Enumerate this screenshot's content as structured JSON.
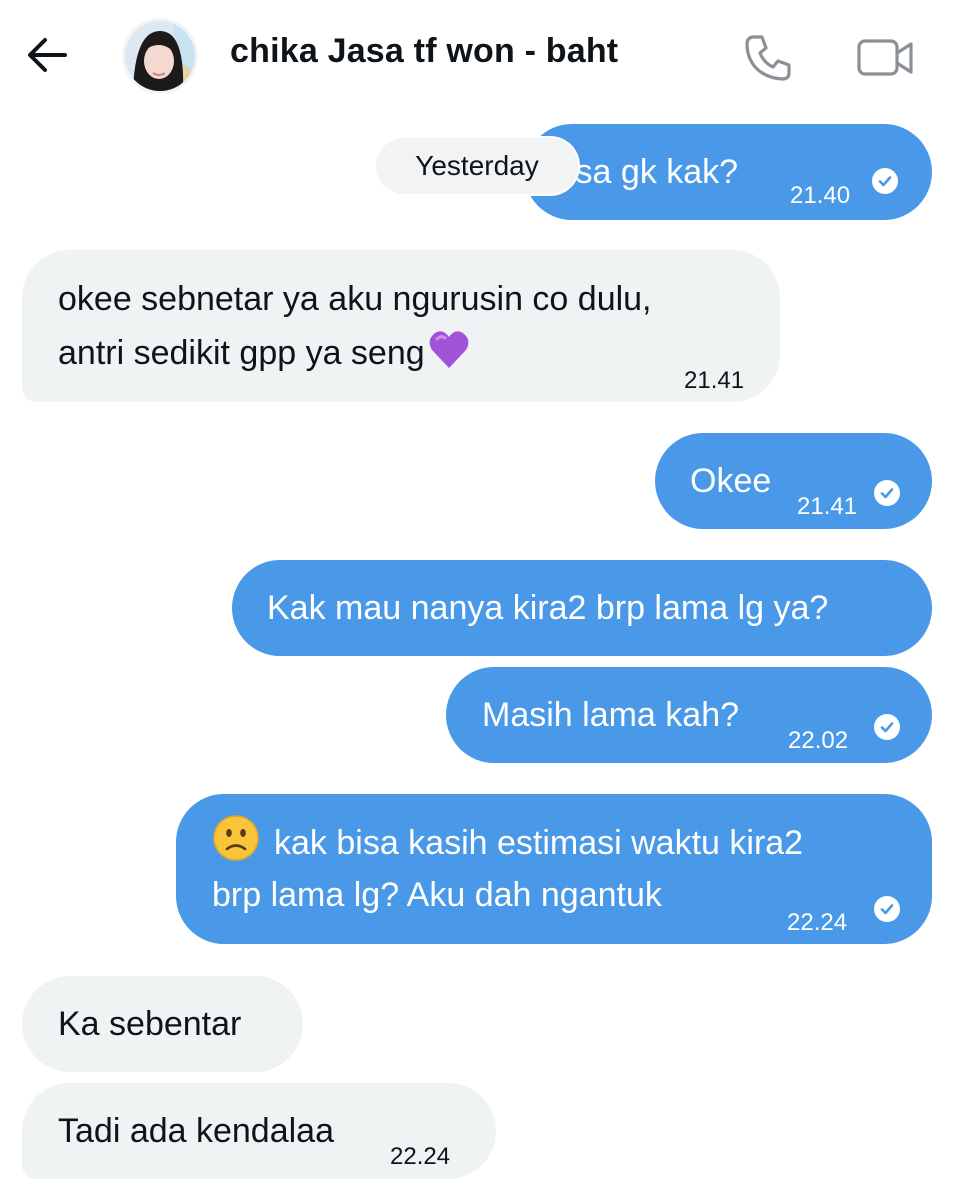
{
  "header": {
    "title": "chika Jasa tf won - baht",
    "back_icon": "arrow-left-icon",
    "call_icon": "phone-icon",
    "video_icon": "video-camera-icon"
  },
  "day_separator": "Yesterday",
  "messages": [
    {
      "dir": "out",
      "text": "Bisa gk kak?",
      "visible_text": "isa gk kak?",
      "time": "21.40",
      "status": "seen"
    },
    {
      "dir": "in",
      "lines": [
        "okee sebnetar ya aku ngurusin co dulu,",
        "antri sedikit gpp ya seng"
      ],
      "emoji": "purple-heart",
      "time": "21.41"
    },
    {
      "dir": "out",
      "text": "Okee",
      "time": "21.41",
      "status": "seen"
    },
    {
      "dir": "out",
      "text": "Kak mau nanya kira2 brp lama lg ya?"
    },
    {
      "dir": "out",
      "text": "Masih lama kah?",
      "time": "22.02",
      "status": "seen"
    },
    {
      "dir": "out",
      "emoji": "slightly-frowning-face",
      "lines": [
        "kak bisa kasih estimasi waktu kira2",
        "brp lama lg? Aku dah ngantuk"
      ],
      "time": "22.24",
      "status": "seen"
    },
    {
      "dir": "in",
      "text": "Ka sebentar"
    },
    {
      "dir": "in",
      "text": "Tadi ada kendalaa",
      "time": "22.24"
    }
  ],
  "colors": {
    "outgoing_bubble": "#4a99e9",
    "incoming_bubble": "#eff3f4",
    "text": "#0f1419"
  }
}
